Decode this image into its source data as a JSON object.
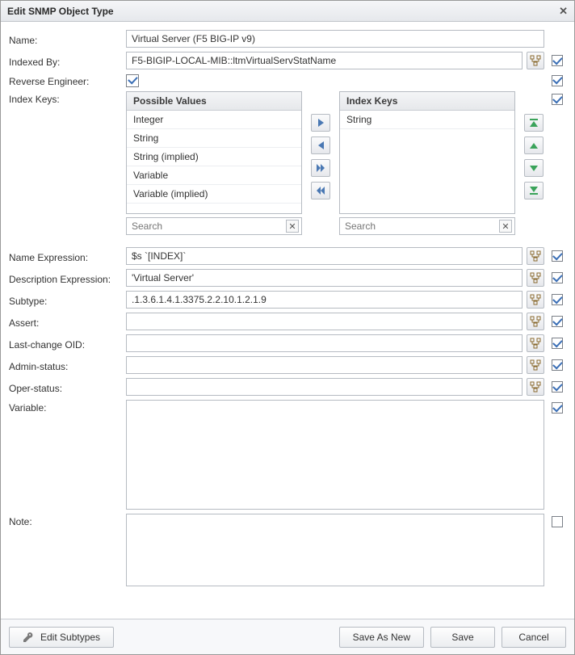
{
  "title": "Edit SNMP Object Type",
  "labels": {
    "name": "Name:",
    "indexedBy": "Indexed By:",
    "reverseEngineer": "Reverse Engineer:",
    "indexKeys": "Index Keys:",
    "nameExpression": "Name Expression:",
    "descriptionExpression": "Description Expression:",
    "subtype": "Subtype:",
    "assert": "Assert:",
    "lastChangeOid": "Last-change OID:",
    "adminStatus": "Admin-status:",
    "operStatus": "Oper-status:",
    "variable": "Variable:",
    "note": "Note:"
  },
  "fields": {
    "name": "Virtual Server (F5 BIG-IP v9)",
    "indexedBy": "F5-BIGIP-LOCAL-MIB::ltmVirtualServStatName",
    "nameExpression": "$s `[INDEX]`",
    "descriptionExpression": "'Virtual Server'",
    "subtype": ".1.3.6.1.4.1.3375.2.2.10.1.2.1.9",
    "assert": "",
    "lastChangeOid": "",
    "adminStatus": "",
    "operStatus": "",
    "variable": "",
    "note": ""
  },
  "picklist": {
    "possibleHeader": "Possible Values",
    "selectedHeader": "Index Keys",
    "possible": [
      "Integer",
      "String",
      "String (implied)",
      "Variable",
      "Variable (implied)"
    ],
    "selected": [
      "String"
    ],
    "searchPlaceholder": "Search"
  },
  "checks": {
    "name": false,
    "indexedBy": true,
    "reverseEngineer": true,
    "reverseEngineerField": true,
    "indexKeys": true,
    "nameExpression": true,
    "descriptionExpression": true,
    "subtype": true,
    "assert": true,
    "lastChangeOid": true,
    "adminStatus": true,
    "operStatus": true,
    "variable": true,
    "note": false
  },
  "footer": {
    "editSubtypes": "Edit Subtypes",
    "saveAsNew": "Save As New",
    "save": "Save",
    "cancel": "Cancel"
  }
}
